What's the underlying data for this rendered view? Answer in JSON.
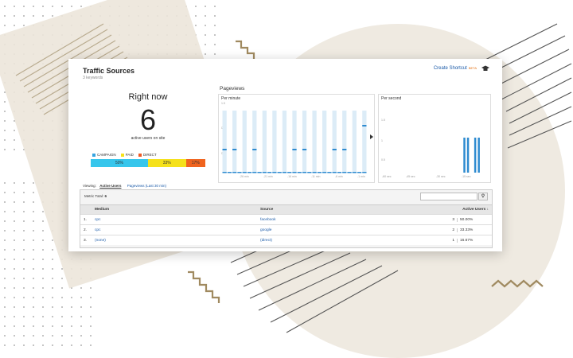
{
  "card": {
    "title": "Traffic Sources",
    "subtitle": "3 keywords",
    "create_shortcut": "Create Shortcut",
    "beta": "BETA",
    "right_now_label": "Right now",
    "active_count": "6",
    "active_sub": "active users on site",
    "legend": [
      {
        "label": "CAMPAIGN",
        "color": "#37a4e0"
      },
      {
        "label": "PAID",
        "color": "#f5e11b"
      },
      {
        "label": "DIRECT",
        "color": "#ef5a24"
      }
    ],
    "segments": [
      {
        "label": "50%",
        "value": 50,
        "color": "#37c6ec"
      },
      {
        "label": "33%",
        "value": 33,
        "color": "#f5e11b"
      },
      {
        "label": "17%",
        "value": 17,
        "color": "#f0641f"
      }
    ]
  },
  "pageviews": {
    "title": "Pageviews",
    "per_minute": {
      "label": "Per minute",
      "y_ticks": [
        "1.5",
        "0.8",
        "0.4"
      ],
      "x_ticks": [
        "-26 min",
        "-21 min",
        "-16 min",
        "-11 min",
        "-6 min",
        "-1 min"
      ],
      "values": [
        1,
        0,
        1,
        0,
        0,
        0,
        1,
        0,
        0,
        0,
        0,
        0,
        0,
        0,
        1,
        0,
        1,
        0,
        0,
        0,
        0,
        0,
        1,
        0,
        1,
        0,
        0,
        0,
        2
      ],
      "bar_color": "#2e8bd0"
    },
    "per_second": {
      "label": "Per second",
      "y_ticks": [
        "1.5",
        "1",
        "0.5"
      ],
      "x_ticks": [
        "-60 sec",
        "-45 sec",
        "-30 sec",
        "-15 sec"
      ],
      "spikes": [
        46,
        48,
        52,
        54
      ],
      "bar_color": "#2e8bd0"
    }
  },
  "table": {
    "viewing_label": "Viewing:",
    "tab_active": "Active Users",
    "tab_link": "Pageviews (Last 30 min)",
    "metric_total_label": "Metric Total:",
    "metric_total_value": "6",
    "headers": [
      "Medium",
      "Source",
      "Active Users"
    ],
    "rows": [
      {
        "idx": "1.",
        "medium": "cpc",
        "source": "facebook",
        "users": "3",
        "pct": "50.00%"
      },
      {
        "idx": "2.",
        "medium": "cpc",
        "source": "google",
        "users": "2",
        "pct": "33.33%"
      },
      {
        "idx": "3.",
        "medium": "(none)",
        "source": "(direct)",
        "users": "1",
        "pct": "16.67%"
      }
    ]
  }
}
